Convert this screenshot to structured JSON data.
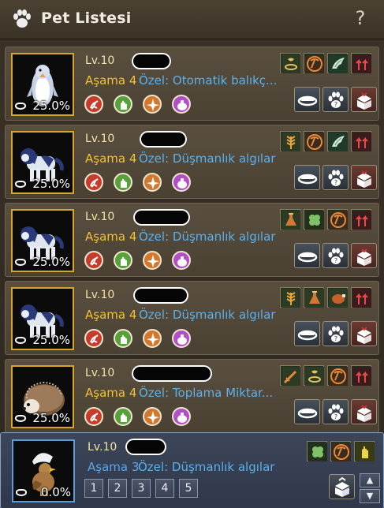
{
  "window": {
    "title": "Pet Listesi",
    "help_label": "?"
  },
  "pets": [
    {
      "level": "Lv.10",
      "stage": "Aşama 4",
      "special": "Özel: Otomatik balıkç...",
      "bond": "25.0%",
      "species": "penguin",
      "skills": [
        "feed-icon",
        "pickaxe-icon",
        "wing-icon",
        "pickup-icon"
      ]
    },
    {
      "level": "Lv.10",
      "stage": "Aşama 4",
      "special": "Özel: Düşmanlık algılar",
      "bond": "25.0%",
      "species": "wolf",
      "skills": [
        "wheat-icon",
        "pickaxe-icon",
        "wing-icon",
        "pickup-icon"
      ]
    },
    {
      "level": "Lv.10",
      "stage": "Aşama 4",
      "special": "Özel: Düşmanlık algılar",
      "bond": "25.0%",
      "species": "wolf",
      "skills": [
        "potion-icon",
        "clover-icon",
        "pickaxe-icon",
        "pickup-icon"
      ]
    },
    {
      "level": "Lv.10",
      "stage": "Aşama 4",
      "special": "Özel: Düşmanlık algılar",
      "bond": "25.0%",
      "species": "wolf",
      "skills": [
        "wheat-icon",
        "potion-icon",
        "meat-icon",
        "pickup-icon"
      ]
    },
    {
      "level": "Lv.10",
      "stage": "Aşama 4",
      "special": "Özel: Toplama Miktar...",
      "bond": "25.0%",
      "species": "hedgehog",
      "skills": [
        "sword-icon",
        "feed-icon",
        "pickaxe-icon",
        "pickup-icon"
      ]
    },
    {
      "level": "Lv.10",
      "stage": "Aşama 3",
      "special": "Özel: Düşmanlık algılar",
      "bond": "0.0%",
      "species": "chick",
      "skills": [
        "clover-icon",
        "pickaxe-icon",
        "hand-icon"
      ]
    }
  ],
  "stat_icons": [
    "run-icon",
    "hand-stat-icon",
    "compass-icon",
    "bag-icon"
  ],
  "action_buttons": [
    "feed-bowl-button",
    "pet-info-button",
    "release-button"
  ],
  "pagination": {
    "pages": [
      "1",
      "2",
      "3",
      "4",
      "5"
    ]
  },
  "colors": {
    "stage_gold": "#f2c233",
    "special_blue": "#5ab1ee",
    "active_border": "#8aa0c8"
  }
}
